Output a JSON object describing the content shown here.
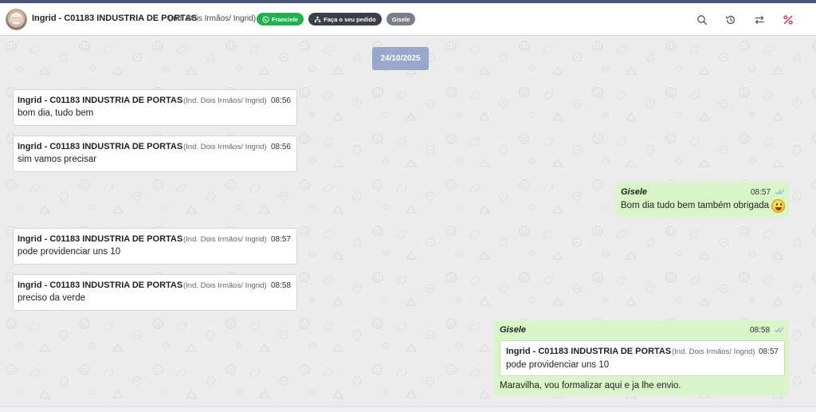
{
  "header": {
    "contact_name": "Ingrid - C01183 INDUSTRIA DE PORTAS",
    "contact_sub": "(Ind. Dois Irmãos/ Ingrid)",
    "chips": {
      "agent": "Franciele",
      "order": "Faça o seu pedido",
      "user": "Gisele"
    },
    "colors": {
      "agent_chip": "#21b24f",
      "order_chip": "#3c3f46",
      "user_chip": "#7c7f86",
      "accent_red": "#e0245e"
    },
    "icons": [
      "search-icon",
      "history-icon",
      "transfer-icon",
      "percent-icon"
    ]
  },
  "chat": {
    "date": "24/10/2025",
    "incoming": [
      {
        "sender": "Ingrid - C01183 INDUSTRIA DE PORTAS",
        "sender_sub": "(Ind. Dois Irmãos/ Ingrid)",
        "time": "08:56",
        "text": "bom dia, tudo bem"
      },
      {
        "sender": "Ingrid - C01183 INDUSTRIA DE PORTAS",
        "sender_sub": "(Ind. Dois Irmãos/ Ingrid)",
        "time": "08:56",
        "text": "sim vamos precisar"
      },
      {
        "sender": "Ingrid - C01183 INDUSTRIA DE PORTAS",
        "sender_sub": "(Ind. Dois Irmãos/ Ingrid)",
        "time": "08:57",
        "text": "pode providenciar uns 10"
      },
      {
        "sender": "Ingrid - C01183 INDUSTRIA DE PORTAS",
        "sender_sub": "(Ind. Dois Irmãos/ Ingrid)",
        "time": "08:58",
        "text": "preciso da verde"
      }
    ],
    "outgoing": [
      {
        "sender": "Gisele",
        "time": "08:57",
        "text": "Bom dia tudo bem também obrigada",
        "emoji": "smiley-emoji"
      },
      {
        "sender": "Gisele",
        "time": "08:58",
        "text": "Maravilha, vou formalizar aqui e ja lhe envio.",
        "quote": {
          "sender": "Ingrid - C01183 INDUSTRIA DE PORTAS",
          "sender_sub": "(Ind. Dois Irmãos/ Ingrid)",
          "time": "08:57",
          "text": "pode providenciar uns 10"
        }
      }
    ],
    "colors": {
      "outgoing_bg": "#d9f6c8",
      "incoming_bg": "#ffffff",
      "date_chip": "#97a8cc",
      "read_check": "#8ab4d8"
    }
  }
}
